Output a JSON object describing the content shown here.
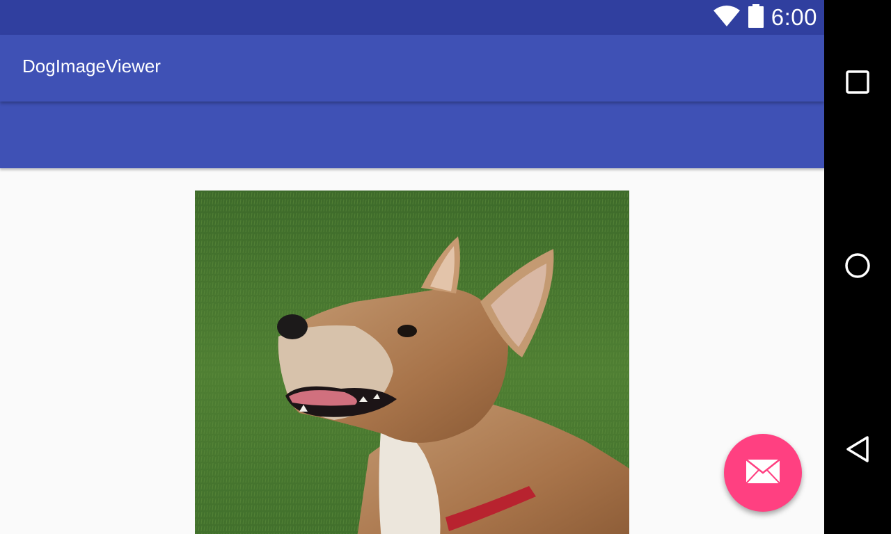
{
  "status_bar": {
    "time": "6:00",
    "icons": [
      "wifi-icon",
      "battery-icon"
    ]
  },
  "app_bar": {
    "title": "DogImageViewer"
  },
  "content": {
    "image": "dog-photo"
  },
  "fab": {
    "icon": "mail-icon"
  },
  "nav_bar": {
    "buttons": [
      "recents-icon",
      "home-icon",
      "back-icon"
    ]
  },
  "colors": {
    "primary": "#3f51b5",
    "primary_dark": "#303f9f",
    "accent": "#ff4081",
    "background": "#fafafa"
  }
}
